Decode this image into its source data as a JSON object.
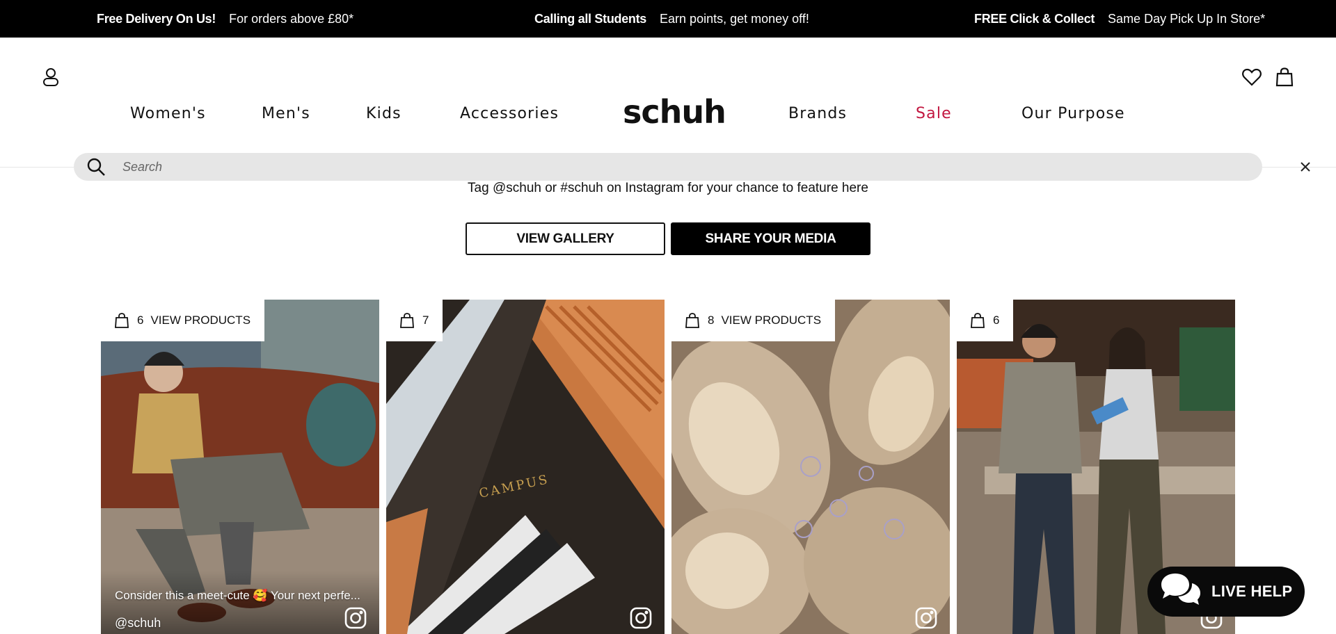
{
  "promo": {
    "delivery_bold": "Free Delivery On Us!",
    "delivery_text": "For orders above £80*",
    "students_bold": "Calling all Students",
    "students_text": "Earn points, get money off!",
    "collect_bold": "FREE Click & Collect",
    "collect_text": "Same Day Pick Up In Store*"
  },
  "header": {
    "logo": "schuh",
    "nav": {
      "womens": "Women's",
      "mens": "Men's",
      "kids": "Kids",
      "accessories": "Accessories",
      "brands": "Brands",
      "sale": "Sale",
      "purpose": "Our Purpose"
    },
    "icons": [
      "account-icon",
      "wishlist-heart-icon",
      "shopping-bag-icon"
    ]
  },
  "search": {
    "placeholder": "Search",
    "value": ""
  },
  "instagram": {
    "tagline": "Tag @schuh or #schuh on Instagram for your chance to feature here",
    "view_gallery": "VIEW GALLERY",
    "share_media": "SHARE YOUR MEDIA",
    "tiles": [
      {
        "count": "6",
        "label": "VIEW PRODUCTS",
        "caption": "Consider this a meet-cute 🥰 Your next perfe...",
        "handle": "@schuh"
      },
      {
        "count": "7",
        "label": "",
        "caption": "",
        "handle": ""
      },
      {
        "count": "8",
        "label": "VIEW PRODUCTS",
        "caption": "",
        "handle": ""
      },
      {
        "count": "6",
        "label": "",
        "caption": "",
        "handle": ""
      }
    ]
  },
  "live_help": {
    "label": "LIVE HELP"
  },
  "colors": {
    "promo_bg": "#000000",
    "sale": "#c2163f",
    "search_bg": "#e6e6e6",
    "live_help_bg": "#0a0a0a"
  }
}
